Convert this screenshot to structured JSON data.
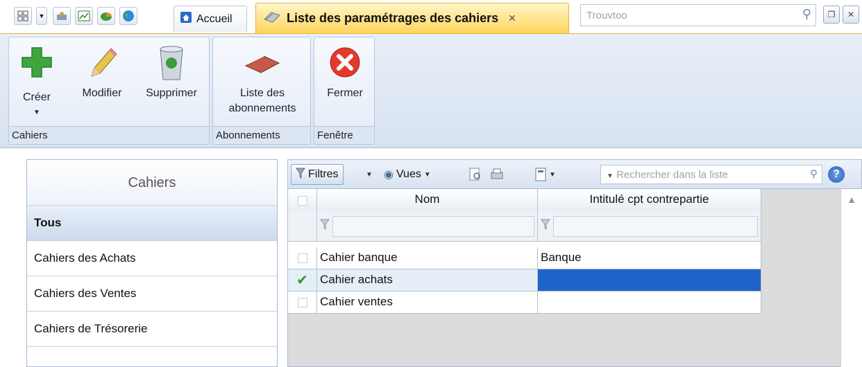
{
  "topbar": {
    "home_tab": "Accueil",
    "active_tab": "Liste des paramétrages des cahiers",
    "search_placeholder": "Trouvtoo"
  },
  "ribbon": {
    "groups": [
      {
        "label": "Cahiers",
        "buttons": [
          "Créer",
          "Modifier",
          "Supprimer"
        ]
      },
      {
        "label": "Abonnements",
        "buttons": [
          "Liste des",
          "abonnements"
        ]
      },
      {
        "label": "Fenêtre",
        "buttons": [
          "Fermer"
        ]
      }
    ]
  },
  "left_panel": {
    "title": "Cahiers",
    "items": [
      "Tous",
      "Cahiers des Achats",
      "Cahiers des Ventes",
      "Cahiers de Trésorerie"
    ]
  },
  "grid": {
    "toolbar": {
      "filters": "Filtres",
      "views": "Vues",
      "search_placeholder": "Rechercher dans la liste"
    },
    "columns": [
      "Nom",
      "Intitulé cpt contrepartie"
    ],
    "rows": [
      {
        "nom": "Cahier banque",
        "intitule": "Banque",
        "selected": false
      },
      {
        "nom": "Cahier achats",
        "intitule": "",
        "selected": true
      },
      {
        "nom": "Cahier ventes",
        "intitule": "",
        "selected": false
      }
    ]
  },
  "colors": {
    "accent_tab": "#ffd45c",
    "selection": "#1e64c8"
  }
}
